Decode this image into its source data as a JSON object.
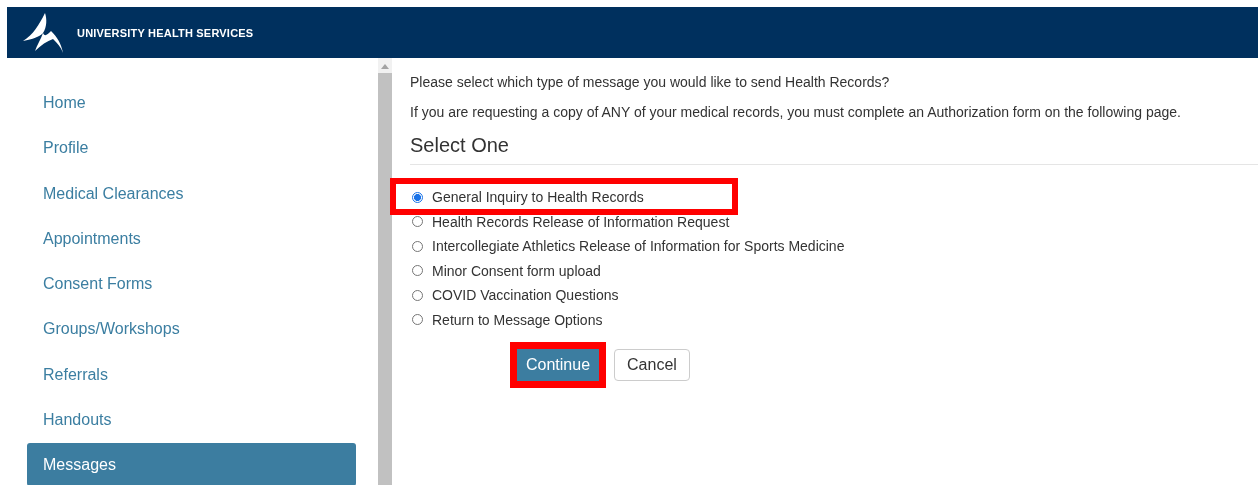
{
  "header": {
    "title": "UNIVERSITY HEALTH SERVICES"
  },
  "sidebar": {
    "items": [
      {
        "label": "Home",
        "selected": false
      },
      {
        "label": "Profile",
        "selected": false
      },
      {
        "label": "Medical Clearances",
        "selected": false
      },
      {
        "label": "Appointments",
        "selected": false
      },
      {
        "label": "Consent Forms",
        "selected": false
      },
      {
        "label": "Groups/Workshops",
        "selected": false
      },
      {
        "label": "Referrals",
        "selected": false
      },
      {
        "label": "Handouts",
        "selected": false
      },
      {
        "label": "Messages",
        "selected": true
      }
    ]
  },
  "content": {
    "intro": "Please select which type of message you would like to send Health Records?",
    "notice": "If you are requesting a copy of ANY of your medical records, you must complete an Authorization form on the following page.",
    "heading": "Select One",
    "options": [
      {
        "label": "General Inquiry to Health Records",
        "selected": true,
        "highlighted": true
      },
      {
        "label": "Health Records Release of Information Request",
        "selected": false,
        "highlighted": false
      },
      {
        "label": "Intercollegiate Athletics Release of Information for Sports Medicine",
        "selected": false,
        "highlighted": false
      },
      {
        "label": "Minor Consent form upload",
        "selected": false,
        "highlighted": false
      },
      {
        "label": "COVID Vaccination Questions",
        "selected": false,
        "highlighted": false
      },
      {
        "label": "Return to Message Options",
        "selected": false,
        "highlighted": false
      }
    ],
    "buttons": [
      {
        "label": "Continue",
        "kind": "primary",
        "highlighted": true
      },
      {
        "label": "Cancel",
        "kind": "default",
        "highlighted": false
      }
    ]
  }
}
